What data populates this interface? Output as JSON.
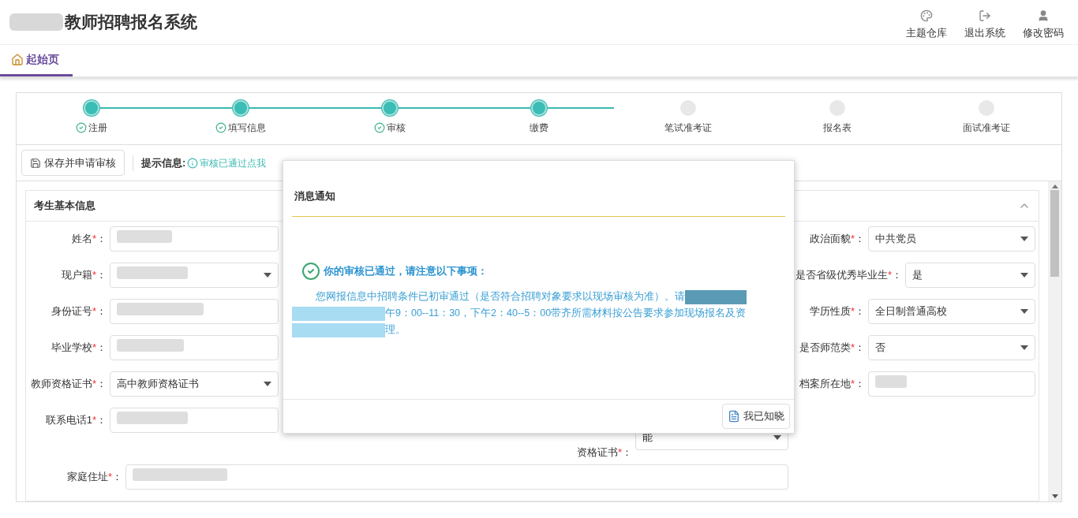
{
  "header": {
    "title": "教师招聘报名系统",
    "actions": [
      {
        "label": "主题仓库",
        "kind": "theme"
      },
      {
        "label": "退出系统",
        "kind": "logout"
      },
      {
        "label": "修改密码",
        "kind": "user"
      }
    ]
  },
  "tabs": [
    {
      "label": "起始页",
      "selected": true
    }
  ],
  "steps": [
    {
      "label": "注册",
      "done": true,
      "checked": true
    },
    {
      "label": "填写信息",
      "done": true,
      "checked": true
    },
    {
      "label": "审核",
      "done": true,
      "checked": true
    },
    {
      "label": "缴费",
      "done": true,
      "checked": false
    },
    {
      "label": "笔试准考证",
      "done": false,
      "checked": false
    },
    {
      "label": "报名表",
      "done": false,
      "checked": false
    },
    {
      "label": "面试准考证",
      "done": false,
      "checked": false
    }
  ],
  "toolbar": {
    "save_button": "保存并申请审核",
    "hint_label": "提示信息:",
    "hint_text": "审核已通过点我"
  },
  "form": {
    "title": "考生基本信息",
    "expanded": true,
    "left_fields": [
      {
        "label": "姓名",
        "mark": "*",
        "colon": "：",
        "kind": "text"
      },
      {
        "label": "现户籍",
        "mark": "*",
        "colon": "：",
        "kind": "select"
      },
      {
        "label": "身份证号",
        "mark": "*",
        "colon": "：",
        "kind": "text"
      },
      {
        "label": "毕业学校",
        "mark": "*",
        "colon": "：",
        "kind": "text"
      },
      {
        "label": "教师资格证书",
        "mark": "*",
        "colon": "：",
        "kind": "select",
        "value": "高中教师资格证书"
      },
      {
        "label": "联系电话1",
        "mark": "*",
        "colon": "：",
        "kind": "text"
      }
    ],
    "middle_field": {
      "label": "资格证书",
      "mark": "*",
      "colon": "：",
      "kind": "select",
      "value": "能"
    },
    "right_fields": [
      {
        "label": "政治面貌",
        "mark": "*",
        "colon": "：",
        "kind": "select",
        "value": "中共党员"
      },
      {
        "label": "是否省级优秀毕业生",
        "mark": "*",
        "colon": "：",
        "kind": "select",
        "value": "是"
      },
      {
        "label": "学历性质",
        "mark": "*",
        "colon": "：",
        "kind": "select",
        "value": "全日制普通高校"
      },
      {
        "label": "是否师范类",
        "mark": "*",
        "colon": "：",
        "kind": "select",
        "value": "否"
      },
      {
        "label": "档案所在地",
        "mark": "*",
        "colon": "：",
        "kind": "text"
      }
    ],
    "address": {
      "label": "家庭住址",
      "mark": "*",
      "colon": "：",
      "kind": "text"
    }
  },
  "dialog": {
    "title": "消息通知",
    "heading": "你的审核已通过，请注意以下事项：",
    "lines": [
      "您网报信息中招聘条件已初审通过（是否符合招聘对象要求以现场审核为准）。请",
      "午9：00--11：30，下午2：40--5：00带齐所需材料按公告要求参加现场报名及资",
      "理。"
    ],
    "button": "我已知晓"
  }
}
